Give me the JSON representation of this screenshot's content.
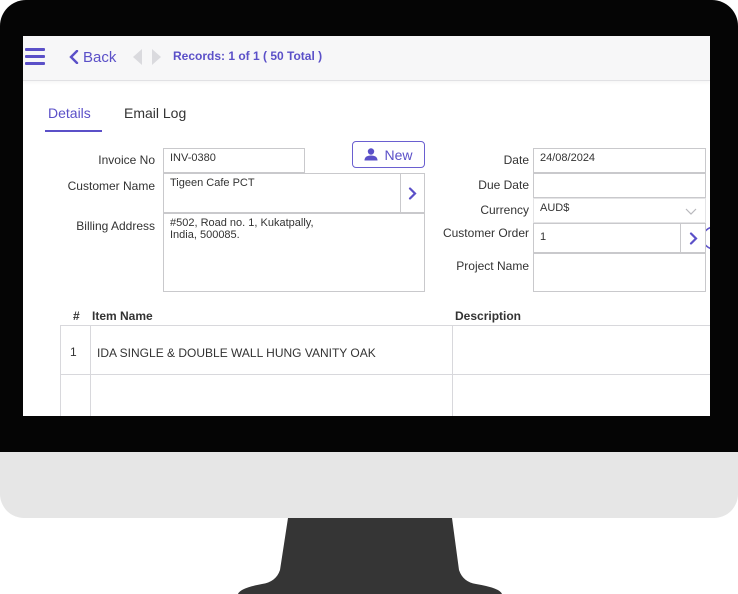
{
  "toolbar": {
    "back_label": "Back",
    "records_label": "Records: 1 of 1  ( 50 Total )"
  },
  "tabs": [
    {
      "label": "Details",
      "active": true
    },
    {
      "label": "Email Log",
      "active": false
    }
  ],
  "form": {
    "invoice_no": {
      "label": "Invoice No",
      "value": "INV-0380"
    },
    "new_button_label": "New",
    "customer_name": {
      "label": "Customer Name",
      "value": "Tigeen Cafe PCT"
    },
    "billing_address": {
      "label": "Billing Address",
      "value_line1": "#502, Road no. 1, Kukatpally,",
      "value_line2": "India, 500085."
    },
    "date": {
      "label": "Date",
      "value": "24/08/2024"
    },
    "due_date": {
      "label": "Due Date",
      "value": ""
    },
    "currency": {
      "label": "Currency",
      "value": "AUD$"
    },
    "customer_order": {
      "label": "Customer Order",
      "value": "1"
    },
    "project_name": {
      "label": "Project Name",
      "value": ""
    }
  },
  "table": {
    "headers": {
      "index": "#",
      "item_name": "Item Name",
      "description": "Description"
    },
    "rows": [
      {
        "index": "1",
        "item_name": "IDA SINGLE & DOUBLE WALL HUNG VANITY OAK",
        "description": ""
      }
    ]
  },
  "colors": {
    "accent": "#5b50c8",
    "bezel": "#050505",
    "chin": "#e6e6e6",
    "stand": "#353535"
  },
  "icons": [
    "menu-icon",
    "chevron-left-icon",
    "user-icon",
    "chevron-right-icon",
    "chevron-down-icon"
  ]
}
